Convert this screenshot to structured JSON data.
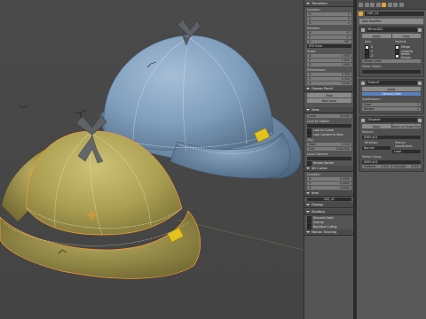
{
  "npanel": {
    "transform_header": "Transform",
    "location_label": "Location:",
    "location_values": [
      "0",
      "0",
      "0"
    ],
    "rotation_label": "Rotation:",
    "rotation_values": [
      "0°",
      "0°",
      "90°"
    ],
    "xyz_euler": "XYZ Euler",
    "scale_label": "Scale:",
    "scale_values": [
      "1.000",
      "1.000",
      "1.000"
    ],
    "dimensions_label": "Dimensions:",
    "dimensions_values": [
      "0.316",
      "0.316",
      "0.134"
    ],
    "grease_pencil_header": "Grease Pencil",
    "gp_new": "New",
    "gp_new_layer": "New Layer",
    "view_header": "View",
    "lens_label": "Lens:",
    "lens_value": "35.000",
    "lock_to_object_label": "Lock to Object:",
    "lock_to_cursor": "Lock to Cursor",
    "lock_camera_to_view": "Lock Camera to View",
    "clip_label": "Clip:",
    "clip_start": "0.100",
    "clip_end": "1000.000",
    "local_camera": "Local Camera:",
    "render_border": "Render Border",
    "cursor_header": "3D Cursor",
    "cursor_location_label": "Location:",
    "cursor_values": [
      "0.0000",
      "0.0000",
      "0.0000"
    ],
    "item_header": "Item",
    "item_name": "HAT_01",
    "display_header": "Display",
    "shading_header": "Shading",
    "textured_solid": "Textured Solid",
    "matcap": "Matcap",
    "backface_culling": "Backface Culling",
    "motion_tracking": "Motion Tracking"
  },
  "props": {
    "object_name": "HAT_01",
    "add_modifier": "Add Modifier",
    "mirror_name": "Mirror.001",
    "apply": "Apply",
    "copy": "Copy",
    "axis_label": "Axis:",
    "options_label": "Options:",
    "axis_x": "X",
    "axis_y": "Y",
    "axis_z": "Z",
    "merge": "Merge",
    "clipping": "Clipping",
    "vertex_groups": "Vertex Groups",
    "merge_limit": "Merge Limit:",
    "mirror_object": "Mirror Object:",
    "subsurf_name": "Subsurf",
    "catmull_clark": "Catmull-Clark",
    "subdivisions": "Subdivisions:",
    "view": "View:",
    "render": "Render:",
    "view_levels": "1",
    "render_levels": "2",
    "displace_name": "Displace",
    "apply2": "Apply",
    "apply_shape": "Apply as Shape Key",
    "texture_label": "Texture:",
    "texture_value": "DISPLACE",
    "direction_label": "Direction:",
    "direction_value": "Normal",
    "texture_coords_label": "Texture Coordinates:",
    "texture_coords_value": "Local",
    "vertex_group_label": "Vertex Group:",
    "vertex_group_value": "DISPLACE",
    "midlevel_label": "Midlevel:",
    "midlevel_value": "0.500",
    "strength_label": "Strength:",
    "strength_value": "0.050"
  },
  "colors": {
    "active_tab": "#e8a23a",
    "blue_hat": "#7f9fbe",
    "olive_hat": "#b2a656",
    "patch": "#e4c21b",
    "bow": "#5e6266"
  }
}
